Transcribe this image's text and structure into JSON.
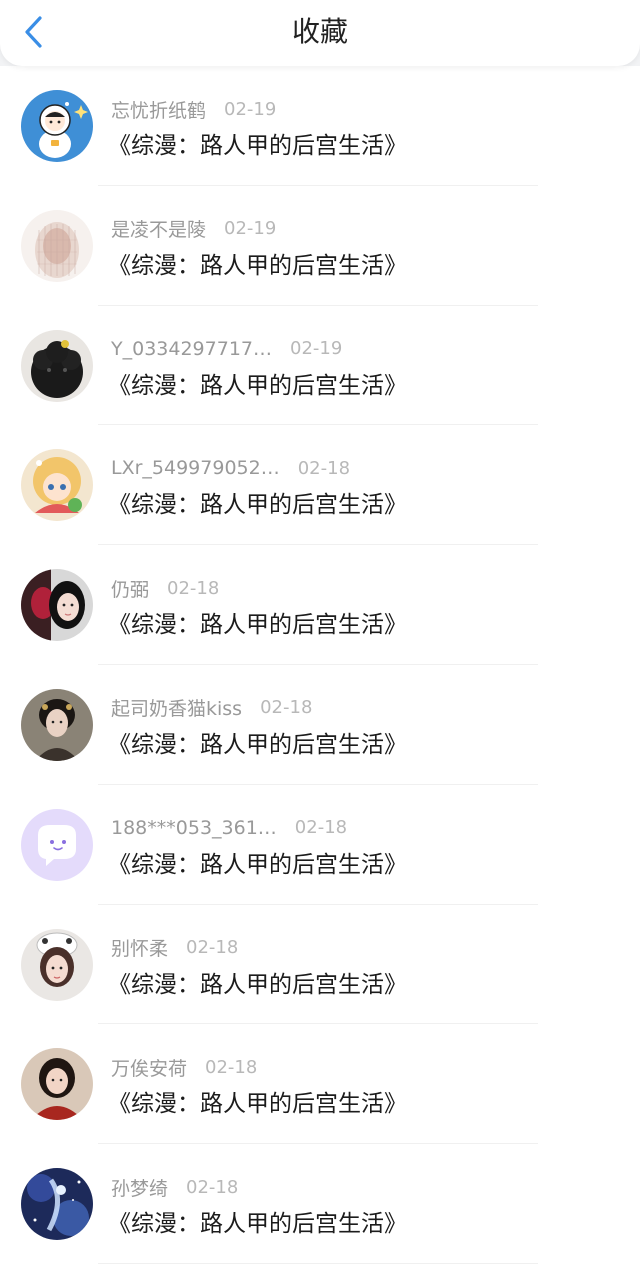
{
  "header": {
    "title": "收藏",
    "back_icon": "chevron-left-icon",
    "accent": "#3a8ee6"
  },
  "favorites": [
    {
      "user": "忘忧折纸鹤",
      "date": "02-19",
      "work": "《综漫：路人甲的后宫生活》",
      "avatar": "astronaut-cartoon"
    },
    {
      "user": "是凌不是陵",
      "date": "02-19",
      "work": "《综漫：路人甲的后宫生活》",
      "avatar": "veiled-figure"
    },
    {
      "user": "Y_0334297717…",
      "date": "02-19",
      "work": "《综漫：路人甲的后宫生活》",
      "avatar": "black-poodle"
    },
    {
      "user": "LXr_549979052…",
      "date": "02-18",
      "work": "《综漫：路人甲的后宫生活》",
      "avatar": "anime-girl"
    },
    {
      "user": "仍弼",
      "date": "02-18",
      "work": "《综漫：路人甲的后宫生活》",
      "avatar": "photo-portrait"
    },
    {
      "user": "起司奶香猫kiss",
      "date": "02-18",
      "work": "《综漫：路人甲的后宫生活》",
      "avatar": "costume-portrait"
    },
    {
      "user": "188***053_361…",
      "date": "02-18",
      "work": "《综漫：路人甲的后宫生活》",
      "avatar": "chat-bubble-default"
    },
    {
      "user": "别怀柔",
      "date": "02-18",
      "work": "《综漫：路人甲的后宫生活》",
      "avatar": "photo-portrait-hat"
    },
    {
      "user": "万俟安荷",
      "date": "02-18",
      "work": "《综漫：路人甲的后宫生活》",
      "avatar": "photo-portrait-red"
    },
    {
      "user": "孙梦绮",
      "date": "02-18",
      "work": "《综漫：路人甲的后宫生活》",
      "avatar": "fantasy-blue"
    }
  ]
}
